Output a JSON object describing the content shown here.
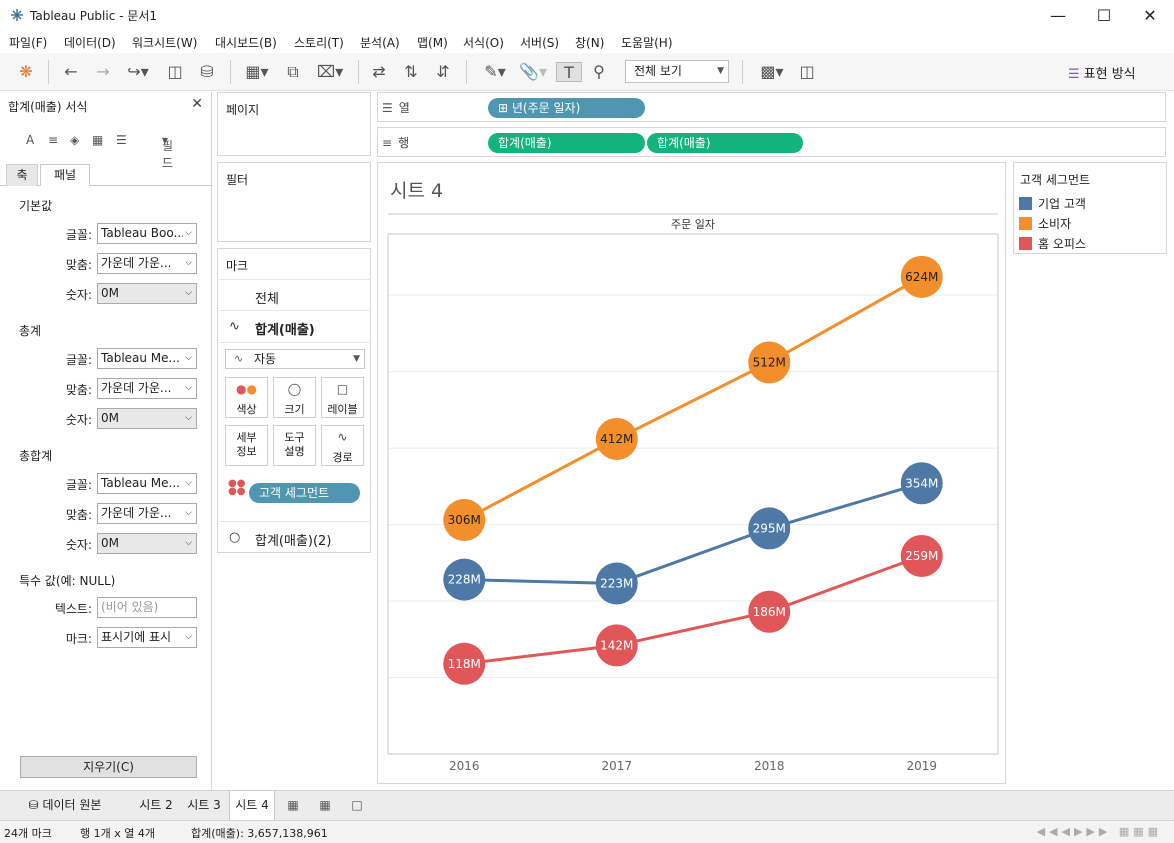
{
  "window": {
    "title": "Tableau Public - 문서1"
  },
  "menu": [
    "파일(F)",
    "데이터(D)",
    "워크시트(W)",
    "대시보드(B)",
    "스토리(T)",
    "분석(A)",
    "맵(M)",
    "서식(O)",
    "서버(S)",
    "창(N)",
    "도움말(H)"
  ],
  "toolbar": {
    "view_select": "전체 보기",
    "show_me": "표현 방식"
  },
  "format_pane": {
    "title": "합계(매출) 서식",
    "fields_label": "필드",
    "tabs": [
      "축",
      "패널"
    ],
    "sections": [
      {
        "heading": "기본값",
        "rows": [
          {
            "label": "글꼴:",
            "value": "Tableau Boo..."
          },
          {
            "label": "맞춤:",
            "value": "가운데 가운..."
          },
          {
            "label": "숫자:",
            "value": "0M"
          }
        ]
      },
      {
        "heading": "총계",
        "rows": [
          {
            "label": "글꼴:",
            "value": "Tableau Me..."
          },
          {
            "label": "맞춤:",
            "value": "가운데 가운..."
          },
          {
            "label": "숫자:",
            "value": "0M"
          }
        ]
      },
      {
        "heading": "총합계",
        "rows": [
          {
            "label": "글꼴:",
            "value": "Tableau Me..."
          },
          {
            "label": "맞춤:",
            "value": "가운데 가운..."
          },
          {
            "label": "숫자:",
            "value": "0M"
          }
        ]
      }
    ],
    "special": {
      "heading": "특수 값(예: NULL)",
      "text_label": "텍스트:",
      "text_placeholder": "(비어 있음)",
      "mark_label": "마크:",
      "mark_value": "표시기에 표시"
    },
    "clear_button": "지우기(C)"
  },
  "cards": {
    "pages": "페이지",
    "filters": "필터",
    "marks": {
      "title": "마크",
      "all": "전체",
      "measure1": "합계(매출)",
      "mark_type": "자동",
      "buttons": [
        "색상",
        "크기",
        "레이블",
        "세부\n정보",
        "도구\n설명",
        "경로"
      ],
      "color_pill": "고객 세그먼트",
      "measure2": "합계(매출)(2)"
    }
  },
  "shelves": {
    "columns_label": "열",
    "rows_label": "행",
    "columns_pill": "년(주문 일자)",
    "rows_pills": [
      "합계(매출)",
      "합계(매출)"
    ]
  },
  "sheet": {
    "title": "시트 4",
    "header": "주문 일자"
  },
  "legend": {
    "title": "고객 세그먼트",
    "items": [
      {
        "name": "기업 고객",
        "color": "#4e79a7"
      },
      {
        "name": "소비자",
        "color": "#f28e2b"
      },
      {
        "name": "홈 오피스",
        "color": "#e15759"
      }
    ]
  },
  "chart_data": {
    "type": "line",
    "title": "시트 4",
    "xlabel": "주문 일자",
    "ylabel": "",
    "categories": [
      "2016",
      "2017",
      "2018",
      "2019"
    ],
    "series": [
      {
        "name": "소비자",
        "color": "#f28e2b",
        "values": [
          306,
          412,
          512,
          624
        ],
        "labels": [
          "306M",
          "412M",
          "512M",
          "624M"
        ]
      },
      {
        "name": "기업 고객",
        "color": "#4e79a7",
        "values": [
          228,
          223,
          295,
          354
        ],
        "labels": [
          "228M",
          "223M",
          "295M",
          "354M"
        ]
      },
      {
        "name": "홈 오피스",
        "color": "#e15759",
        "values": [
          118,
          142,
          186,
          259
        ],
        "labels": [
          "118M",
          "142M",
          "186M",
          "259M"
        ]
      }
    ],
    "ylim": [
      0,
      680
    ],
    "grid": true,
    "legend": "right"
  },
  "bottom_tabs": {
    "datasource": "데이터 원본",
    "sheets": [
      "시트 2",
      "시트 3",
      "시트 4"
    ],
    "active": "시트 4"
  },
  "status": {
    "marks": "24개 마크",
    "rows_cols": "행 1개 x 열 4개",
    "sum": "합계(매출): 3,657,138,961"
  }
}
